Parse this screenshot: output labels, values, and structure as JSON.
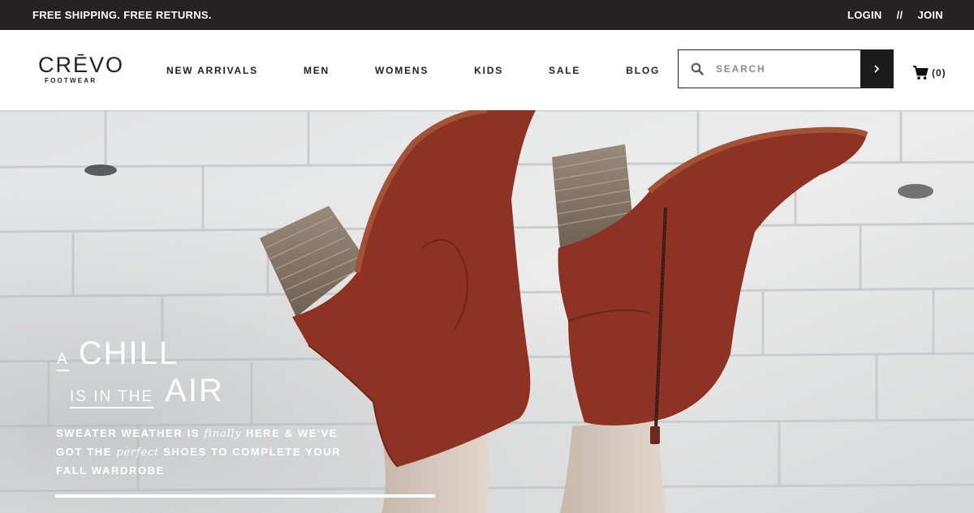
{
  "topbar": {
    "promo": "FREE SHIPPING. FREE RETURNS.",
    "login": "LOGIN",
    "separator": "//",
    "join": "JOIN"
  },
  "header": {
    "logo": {
      "brand": "CRĒVO",
      "sub": "FOOTWEAR"
    },
    "nav": [
      {
        "label": "NEW ARRIVALS"
      },
      {
        "label": "MEN"
      },
      {
        "label": "WOMENS"
      },
      {
        "label": "KIDS"
      },
      {
        "label": "SALE"
      },
      {
        "label": "BLOG"
      }
    ],
    "search": {
      "placeholder": "SEARCH",
      "icon": "search-icon",
      "submit_icon": "chevron-right-icon"
    },
    "cart": {
      "icon": "cart-icon",
      "count": "(0)"
    }
  },
  "hero": {
    "headline": {
      "a": "A",
      "chill": "CHILL",
      "is_in_the": "IS IN THE",
      "air": "AIR"
    },
    "subcopy": {
      "part1": "SWEATER WEATHER IS ",
      "em1": "finally",
      "part2": " HERE & WE'VE GOT THE ",
      "em2": "perfect",
      "part3": " SHOES TO COMPLETE YOUR FALL WARDROBE"
    }
  },
  "colors": {
    "topbar_bg": "#262223",
    "boot_suede": "#8e3324",
    "heel_wood": "#8a7b6b",
    "wall": "#e4e5e6",
    "accent_dark": "#1b1b1b"
  }
}
